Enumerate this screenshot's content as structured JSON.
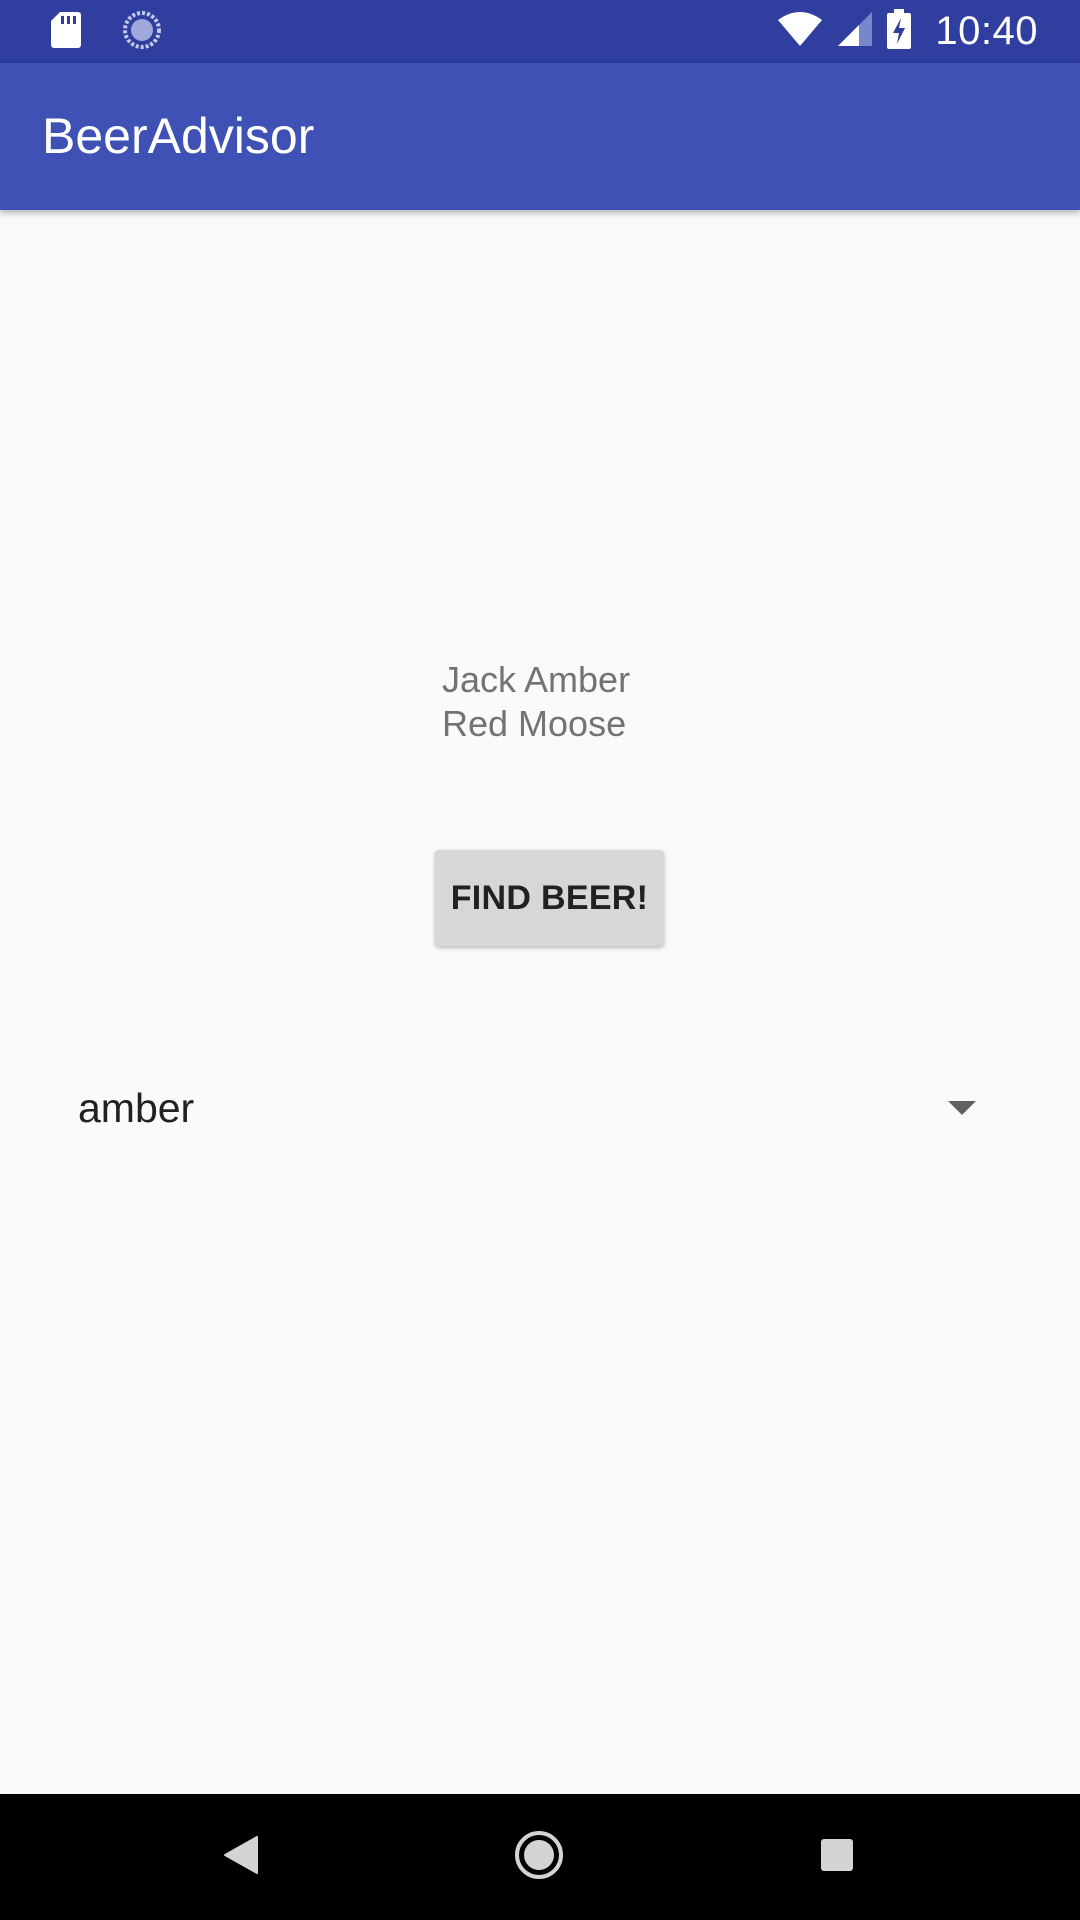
{
  "status_bar": {
    "time": "10:40",
    "background": "#303f9f",
    "left_icons": [
      "sd-card-icon",
      "sync-icon"
    ],
    "right_icons": [
      "wifi-icon",
      "cellular-signal-icon",
      "battery-charging-icon"
    ]
  },
  "app_bar": {
    "title": "BeerAdvisor",
    "background": "#3f51b5"
  },
  "main": {
    "brands": [
      "Jack Amber",
      "Red Moose"
    ],
    "find_button_label": "FIND BEER!",
    "color_spinner": {
      "selected": "amber",
      "icon": "dropdown-arrow-icon"
    }
  },
  "nav_bar": {
    "buttons": [
      "back-icon",
      "home-icon",
      "recents-icon"
    ]
  }
}
